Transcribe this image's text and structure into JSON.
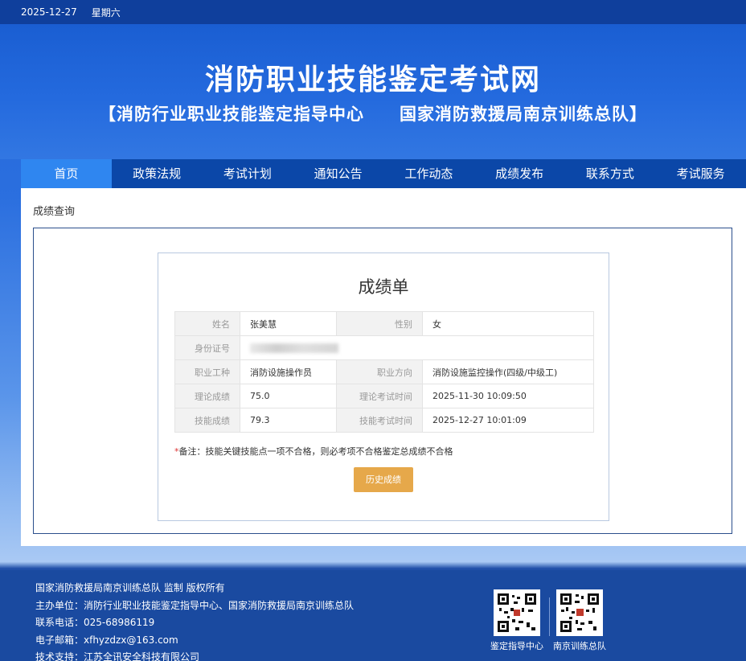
{
  "topbar": {
    "date": "2025-12-27",
    "weekday": "星期六"
  },
  "header": {
    "title": "消防职业技能鉴定考试网",
    "subtitle": "【消防行业职业技能鉴定指导中心　　国家消防救援局南京训练总队】"
  },
  "nav": {
    "items": [
      {
        "label": "首页"
      },
      {
        "label": "政策法规"
      },
      {
        "label": "考试计划"
      },
      {
        "label": "通知公告"
      },
      {
        "label": "工作动态"
      },
      {
        "label": "成绩发布"
      },
      {
        "label": "联系方式"
      },
      {
        "label": "考试服务"
      }
    ]
  },
  "page": {
    "breadcrumb": "成绩查询"
  },
  "report": {
    "title": "成绩单",
    "rows": {
      "name_label": "姓名",
      "name_value": "张美慧",
      "gender_label": "性别",
      "gender_value": "女",
      "id_label": "身份证号",
      "job_label": "职业工种",
      "job_value": "消防设施操作员",
      "direction_label": "职业方向",
      "direction_value": "消防设施监控操作(四级/中级工)",
      "theory_label": "理论成绩",
      "theory_value": "75.0",
      "theory_time_label": "理论考试时间",
      "theory_time_value": "2025-11-30 10:09:50",
      "skill_label": "技能成绩",
      "skill_value": "79.3",
      "skill_time_label": "技能考试时间",
      "skill_time_value": "2025-12-27 10:01:09"
    },
    "note_star": "*",
    "note_text": "备注：技能关键技能点一项不合格，则必考项不合格鉴定总成绩不合格",
    "history_button": "历史成绩"
  },
  "footer": {
    "line1": "国家消防救援局南京训练总队 监制 版权所有",
    "line2": "主办单位：消防行业职业技能鉴定指导中心、国家消防救援局南京训练总队",
    "line3": "联系电话：025-68986119",
    "line4": "电子邮箱：xfhyzdzx@163.com",
    "line5": "技术支持：江苏全讯安全科技有限公司",
    "qr1_label": "鉴定指导中心",
    "qr2_label": "南京训练总队"
  }
}
